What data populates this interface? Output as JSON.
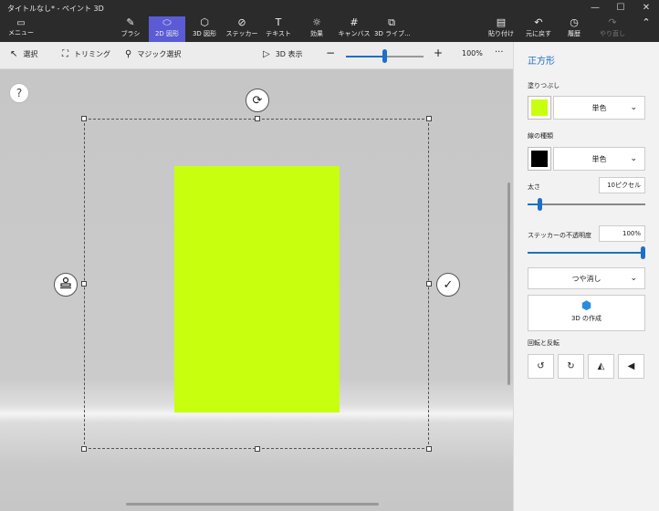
{
  "window": {
    "title": "タイトルなし* - ペイント 3D",
    "controls": [
      "—",
      "☐",
      "✕"
    ]
  },
  "ribbon": {
    "menu_label": "メニュー",
    "tools": [
      {
        "label": "ブラシ",
        "icon": "brush-icon"
      },
      {
        "label": "2D 図形",
        "icon": "2d-shapes-icon"
      },
      {
        "label": "3D 図形",
        "icon": "3d-shapes-icon"
      },
      {
        "label": "ステッカー",
        "icon": "sticker-icon"
      },
      {
        "label": "テキスト",
        "icon": "text-icon"
      },
      {
        "label": "効果",
        "icon": "effects-icon"
      },
      {
        "label": "キャンバス",
        "icon": "canvas-icon"
      },
      {
        "label": "3D ライブ...",
        "icon": "3d-library-icon"
      }
    ],
    "actions": [
      {
        "label": "貼り付け",
        "icon": "paste-icon"
      },
      {
        "label": "元に戻す",
        "icon": "undo-icon"
      },
      {
        "label": "履歴",
        "icon": "history-icon"
      },
      {
        "label": "やり直し",
        "icon": "redo-icon"
      }
    ]
  },
  "toolbar": {
    "select": "選択",
    "crop": "トリミング",
    "magic_select": "マジック選択",
    "view_3d": "3D 表示",
    "zoom_out": "−",
    "zoom_in": "+",
    "zoom_value": "100%",
    "zoom_level": 0.5,
    "more": "···"
  },
  "canvas": {
    "help": "?",
    "rotate_icon": "⟳",
    "stamp_icon": "stamp-icon",
    "confirm_icon": "✓",
    "shape_color": "#c8ff0f"
  },
  "panel": {
    "title": "正方形",
    "fill_label": "塗りつぶし",
    "fill_color": "#c8ff0f",
    "fill_type": "単色",
    "line_label": "線の種類",
    "line_color": "#000000",
    "line_type": "単色",
    "thickness_label": "太さ",
    "thickness_value": "10ピクセル",
    "thickness_level": 0.1,
    "opacity_label": "ステッカーの不透明度",
    "opacity_value": "100%",
    "opacity_level": 1.0,
    "finish": "つや消し",
    "make_3d": "3D の作成",
    "rotate_flip_label": "回転と反転"
  }
}
